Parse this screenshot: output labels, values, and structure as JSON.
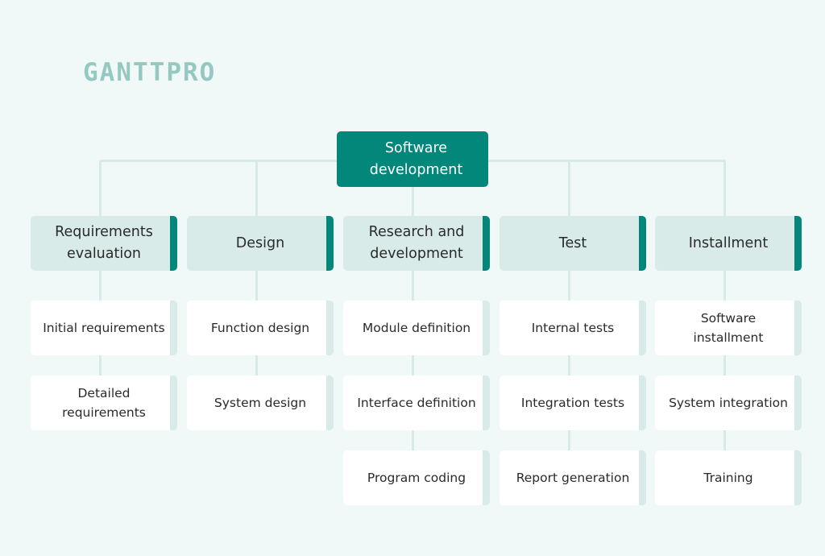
{
  "brand": {
    "logo_text": "GANTTPRO",
    "logo_color": "#96c8c2"
  },
  "colors": {
    "background": "#f1f8f8",
    "root_fill": "#02877a",
    "category_fill": "#d8ebe9",
    "category_accent": "#02877a",
    "child_fill": "#ffffff",
    "connector": "#d6eae8"
  },
  "root": {
    "label": "Software development"
  },
  "categories": [
    {
      "label": "Requirements evaluation",
      "children": [
        "Initial requirements",
        "Detailed requirements"
      ]
    },
    {
      "label": "Design",
      "children": [
        "Function design",
        "System design"
      ]
    },
    {
      "label": "Research and development",
      "children": [
        "Module definition",
        "Interface definition",
        "Program coding"
      ]
    },
    {
      "label": "Test",
      "children": [
        "Internal tests",
        "Integration tests",
        "Report generation"
      ]
    },
    {
      "label": "Installment",
      "children": [
        "Software installment",
        "System integration",
        "Training"
      ]
    }
  ]
}
